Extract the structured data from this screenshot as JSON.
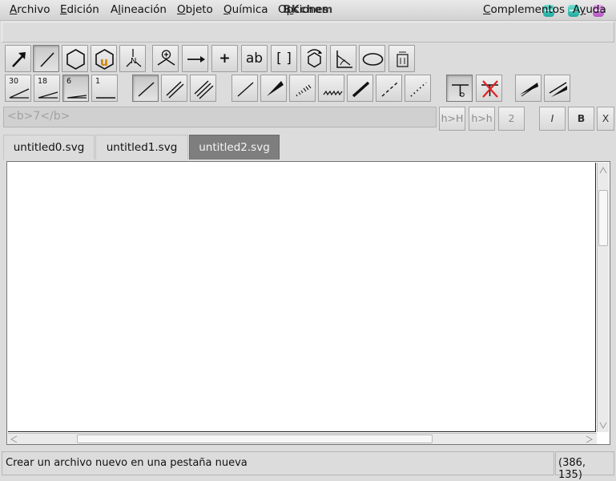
{
  "window": {
    "title": "BKchem"
  },
  "menubar": {
    "items": [
      {
        "label": "Archivo",
        "key": "A"
      },
      {
        "label": "Edición",
        "key": "E"
      },
      {
        "label": "Alineación",
        "key": "l"
      },
      {
        "label": "Objeto",
        "key": "O"
      },
      {
        "label": "Química",
        "key": "Q"
      },
      {
        "label": "Opciones",
        "key": "p"
      }
    ],
    "right_items": [
      {
        "label": "Complementos",
        "key": "C"
      },
      {
        "label": "Ayuda",
        "key": "y"
      }
    ]
  },
  "toolbar_modes": [
    {
      "name": "edit-mode",
      "icon": "arrow-icon"
    },
    {
      "name": "draw-mode",
      "icon": "bond-line-icon"
    },
    {
      "name": "template-mode",
      "icon": "hexagon-icon"
    },
    {
      "name": "user-template-mode",
      "icon": "user-template-icon"
    },
    {
      "name": "biomolecule-template-mode",
      "icon": "nitrogen-template-icon"
    },
    {
      "name": "atom-charge-mode",
      "icon": "charge-icon"
    },
    {
      "name": "arrow-mode",
      "icon": "reaction-arrow-icon"
    },
    {
      "name": "plus-mode",
      "icon": "plus-icon",
      "glyph": "+"
    },
    {
      "name": "text-mode",
      "icon": "text-icon",
      "glyph": "ab"
    },
    {
      "name": "bracket-mode",
      "icon": "bracket-icon",
      "glyph": "[ ]"
    },
    {
      "name": "rotate-mode",
      "icon": "rotate-icon"
    },
    {
      "name": "bond-align-mode",
      "icon": "bond-align-icon"
    },
    {
      "name": "vector-mode",
      "icon": "ellipse-icon"
    },
    {
      "name": "misc-mode",
      "icon": "trash-icon"
    }
  ],
  "bond_angles": [
    "30",
    "18",
    "6",
    "1"
  ],
  "markup_field": {
    "value": "<b>7</b>"
  },
  "format_buttons": [
    "h>H",
    "h>h",
    "2",
    "I",
    "B",
    "X"
  ],
  "tabs": [
    "untitled0.svg",
    "untitled1.svg",
    "untitled2.svg"
  ],
  "active_tab": "untitled2.svg",
  "statusbar": {
    "message": "Crear un archivo nuevo en una pestaña nueva",
    "coords": "(386, 135)"
  },
  "colors": {
    "active_tab": "#7e7e7e",
    "user_template": "#cc8400",
    "delete_x": "#e02020"
  }
}
